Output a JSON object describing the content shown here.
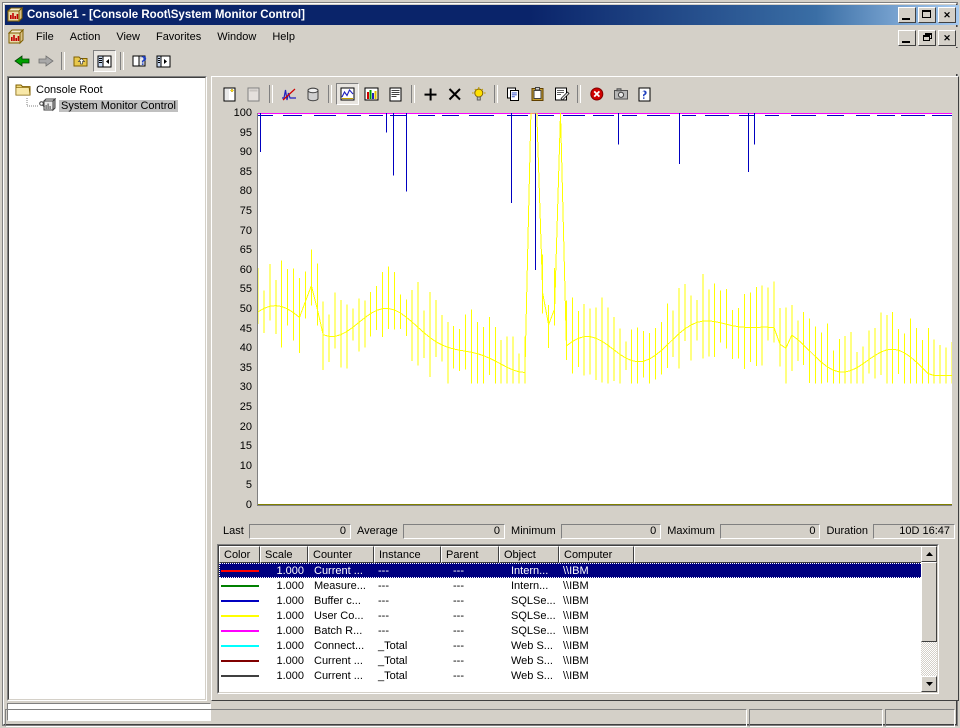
{
  "window": {
    "title": "Console1 - [Console Root\\System Monitor Control]",
    "icon": "mmc-console-icon",
    "buttons": {
      "minimize": "_",
      "maximize": "□",
      "close": "✕"
    },
    "mdi_buttons": {
      "minimize": "_",
      "restore": "❐",
      "close": "✕"
    }
  },
  "menubar": {
    "icon": "mmc-console-icon",
    "items": [
      {
        "label": "File"
      },
      {
        "label": "Action"
      },
      {
        "label": "View"
      },
      {
        "label": "Favorites"
      },
      {
        "label": "Window"
      },
      {
        "label": "Help"
      }
    ]
  },
  "mmc_toolbar": {
    "buttons": [
      {
        "name": "back-arrow-icon",
        "title": "Back"
      },
      {
        "name": "forward-arrow-icon",
        "title": "Forward"
      },
      {
        "name": "up-one-level-icon",
        "title": "Up One Level"
      },
      {
        "name": "show-hide-console-tree-icon",
        "title": "Show/Hide Console Tree",
        "pressed": true
      },
      {
        "name": "help-book-icon",
        "title": "Help"
      },
      {
        "name": "export-list-icon",
        "title": "Export List"
      }
    ]
  },
  "tree": {
    "nodes": [
      {
        "label": "Console Root",
        "icon": "folder-icon",
        "selected": false
      },
      {
        "label": "System Monitor Control",
        "icon": "system-monitor-icon",
        "selected": true
      }
    ]
  },
  "sysmon_toolbar": {
    "buttons": [
      {
        "name": "new-counter-set-icon",
        "title": "New Counter Set"
      },
      {
        "name": "clear-display-icon",
        "title": "Clear Display"
      },
      {
        "name": "view-current-activity-icon",
        "title": "View Current Activity"
      },
      {
        "name": "view-log-data-icon",
        "title": "View Log Data"
      },
      {
        "name": "view-graph-icon",
        "title": "View Graph",
        "pressed": true
      },
      {
        "name": "view-histogram-icon",
        "title": "View Histogram"
      },
      {
        "name": "view-report-icon",
        "title": "View Report"
      },
      {
        "name": "add-counter-icon",
        "title": "Add"
      },
      {
        "name": "delete-counter-icon",
        "title": "Delete"
      },
      {
        "name": "highlight-icon",
        "title": "Highlight"
      },
      {
        "name": "copy-properties-icon",
        "title": "Copy Properties"
      },
      {
        "name": "paste-counter-list-icon",
        "title": "Paste Counter List"
      },
      {
        "name": "properties-icon",
        "title": "Properties"
      },
      {
        "name": "freeze-display-icon",
        "title": "Freeze Display"
      },
      {
        "name": "update-data-icon",
        "title": "Update Data"
      },
      {
        "name": "help-icon",
        "title": "Help"
      }
    ]
  },
  "chart_data": {
    "type": "line",
    "title": "",
    "xlabel": "",
    "ylabel": "",
    "ylim": [
      0,
      100
    ],
    "yticks": [
      100,
      95,
      90,
      85,
      80,
      75,
      70,
      65,
      60,
      55,
      50,
      45,
      40,
      35,
      30,
      25,
      20,
      15,
      10,
      5,
      0
    ],
    "grid": false,
    "legend_position": "bottom-table",
    "series": [
      {
        "name": "Current ... (Intern...)",
        "color": "#ff0000",
        "scale": "1.000",
        "values": [
          0,
          0,
          0,
          0,
          0,
          0,
          0,
          0,
          0,
          0,
          0,
          0,
          0,
          0,
          0,
          0,
          0,
          0,
          0,
          0
        ]
      },
      {
        "name": "Measure... (Intern...)",
        "color": "#008000",
        "scale": "1.000",
        "values": [
          0,
          0,
          0,
          0,
          0,
          0,
          0,
          0,
          0,
          0,
          0,
          0,
          0,
          0,
          0,
          0,
          0,
          0,
          0,
          0
        ]
      },
      {
        "name": "Buffer c... (SQLSe...)",
        "color": "#0000c0",
        "scale": "1.000",
        "values": [
          100,
          95,
          100,
          100,
          100,
          100,
          100,
          100,
          100,
          100,
          100,
          100,
          97,
          97,
          100,
          100,
          100,
          100,
          100,
          100,
          100,
          100,
          100,
          100,
          100,
          100,
          97,
          100,
          100,
          93,
          100,
          100,
          90,
          100,
          100,
          100,
          100,
          100,
          100,
          100,
          100,
          100,
          100,
          100,
          100,
          100,
          100,
          100,
          100,
          100,
          100,
          100,
          100,
          100,
          100,
          100,
          100,
          100,
          100,
          100,
          100,
          100,
          100,
          100,
          100,
          100,
          100,
          100,
          100,
          100,
          95,
          100,
          100,
          95,
          100,
          100,
          100,
          100,
          100,
          100,
          100,
          100,
          100,
          100,
          100,
          100,
          100,
          100,
          100,
          100,
          100,
          100,
          100,
          100,
          100,
          100,
          100,
          100,
          100,
          100
        ]
      },
      {
        "name": "User Co... (SQLSe...)",
        "color": "#ffff00",
        "scale": "1.000",
        "values": [
          48,
          46,
          44,
          43,
          44,
          43,
          44,
          45,
          52,
          56,
          50,
          47,
          46,
          48,
          44,
          41,
          40,
          43,
          46,
          48,
          47,
          46,
          45,
          44,
          43,
          42,
          44,
          45,
          46,
          44,
          43,
          44,
          46,
          44,
          45,
          46,
          45,
          44,
          43,
          46,
          48,
          47,
          45,
          44,
          46,
          48,
          100,
          100,
          54,
          46,
          50,
          100,
          48,
          46,
          45,
          44,
          45,
          44,
          43,
          42,
          41,
          42,
          41,
          40,
          44,
          46,
          45,
          44,
          46,
          45,
          43,
          42,
          40,
          39,
          44,
          48,
          46,
          45,
          47,
          46,
          45,
          44,
          45,
          46,
          44,
          43,
          44,
          45,
          44,
          43,
          42,
          40,
          41,
          40,
          39,
          40,
          41,
          40,
          40,
          39
        ]
      },
      {
        "name": "Batch R... (SQLSe...)",
        "color": "#ff00ff",
        "scale": "1.000",
        "values": [
          100,
          100,
          100,
          100,
          100,
          100,
          100,
          100,
          100,
          100,
          100,
          100,
          100,
          100,
          100,
          100,
          100,
          100,
          100,
          100
        ]
      },
      {
        "name": "Connect... (Web S...)",
        "color": "#00ffff",
        "scale": "1.000",
        "values": [
          0,
          0,
          0,
          0,
          0,
          0,
          0,
          0,
          0,
          0,
          0,
          0,
          0,
          0,
          0,
          0,
          0,
          0,
          0,
          0
        ]
      },
      {
        "name": "Current ... (Web S...)",
        "color": "#800000",
        "scale": "1.000",
        "values": [
          0,
          0,
          0,
          0,
          0,
          0,
          0,
          0,
          0,
          0,
          0,
          0,
          0,
          0,
          0,
          0,
          0,
          0,
          0,
          0
        ]
      },
      {
        "name": "Current ... (Web S...)",
        "color": "#404040",
        "scale": "1.000",
        "values": [
          0,
          0,
          0,
          0,
          0,
          0,
          0,
          0,
          0,
          0,
          0,
          0,
          0,
          0,
          0,
          0,
          0,
          0,
          0,
          0
        ]
      }
    ]
  },
  "valuebar": {
    "fields": [
      {
        "label": "Last",
        "value": "0"
      },
      {
        "label": "Average",
        "value": "0"
      },
      {
        "label": "Minimum",
        "value": "0"
      },
      {
        "label": "Maximum",
        "value": "0"
      },
      {
        "label": "Duration",
        "value": "10D 16:47"
      }
    ]
  },
  "legend": {
    "columns": [
      "Color",
      "Scale",
      "Counter",
      "Instance",
      "Parent",
      "Object",
      "Computer"
    ],
    "rows": [
      {
        "color": "#ff0000",
        "scale": "1.000",
        "counter": "Current ...",
        "instance": "---",
        "parent": "---",
        "object": "Intern...",
        "computer": "\\\\IBM",
        "selected": true
      },
      {
        "color": "#008000",
        "scale": "1.000",
        "counter": "Measure...",
        "instance": "---",
        "parent": "---",
        "object": "Intern...",
        "computer": "\\\\IBM",
        "selected": false
      },
      {
        "color": "#0000c0",
        "scale": "1.000",
        "counter": "Buffer c...",
        "instance": "---",
        "parent": "---",
        "object": "SQLSe...",
        "computer": "\\\\IBM",
        "selected": false
      },
      {
        "color": "#ffff00",
        "scale": "1.000",
        "counter": "User Co...",
        "instance": "---",
        "parent": "---",
        "object": "SQLSe...",
        "computer": "\\\\IBM",
        "selected": false
      },
      {
        "color": "#ff00ff",
        "scale": "1.000",
        "counter": "Batch R...",
        "instance": "---",
        "parent": "---",
        "object": "SQLSe...",
        "computer": "\\\\IBM",
        "selected": false
      },
      {
        "color": "#00ffff",
        "scale": "1.000",
        "counter": "Connect...",
        "instance": "_Total",
        "parent": "---",
        "object": "Web S...",
        "computer": "\\\\IBM",
        "selected": false
      },
      {
        "color": "#800000",
        "scale": "1.000",
        "counter": "Current ...",
        "instance": "_Total",
        "parent": "---",
        "object": "Web S...",
        "computer": "\\\\IBM",
        "selected": false
      },
      {
        "color": "#404040",
        "scale": "1.000",
        "counter": "Current ...",
        "instance": "_Total",
        "parent": "---",
        "object": "Web S...",
        "computer": "\\\\IBM",
        "selected": false
      }
    ]
  },
  "bottom_edit": {
    "value": ""
  },
  "statusbar": {
    "panels": [
      "",
      "",
      ""
    ]
  }
}
